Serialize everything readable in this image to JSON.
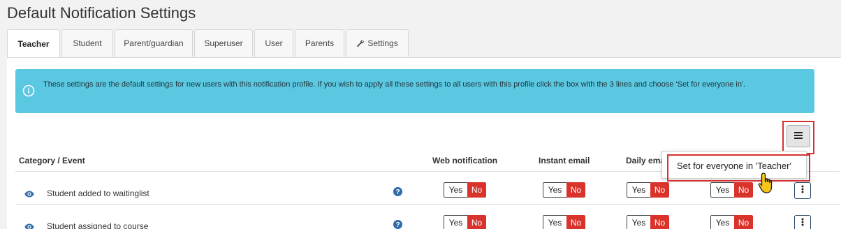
{
  "page": {
    "title": "Default Notification Settings"
  },
  "tabs": [
    {
      "label": "Teacher",
      "active": true
    },
    {
      "label": "Student"
    },
    {
      "label": "Parent/guardian"
    },
    {
      "label": "Superuser"
    },
    {
      "label": "User"
    },
    {
      "label": "Parents"
    },
    {
      "label": "Settings",
      "icon": "wrench-icon"
    }
  ],
  "info": {
    "text": "These settings are the default settings for new users with this notification profile. If you wish to apply all these settings to all users with this profile click the box with the 3 lines and choose 'Set for everyone in'."
  },
  "table": {
    "columns": [
      "Category / Event",
      "Web notification",
      "Instant email",
      "Daily ema"
    ],
    "rows": [
      {
        "label": "Student added to waitinglist"
      },
      {
        "label": "Student assigned to course"
      }
    ],
    "toggle": {
      "yes": "Yes",
      "no": "No"
    }
  },
  "dropdown": {
    "item": "Set for everyone in 'Teacher'"
  },
  "colors": {
    "info_bg": "#5bc8e2",
    "no_red": "#d9342b",
    "highlight": "#d43232",
    "icon_blue": "#2f6ca8"
  }
}
